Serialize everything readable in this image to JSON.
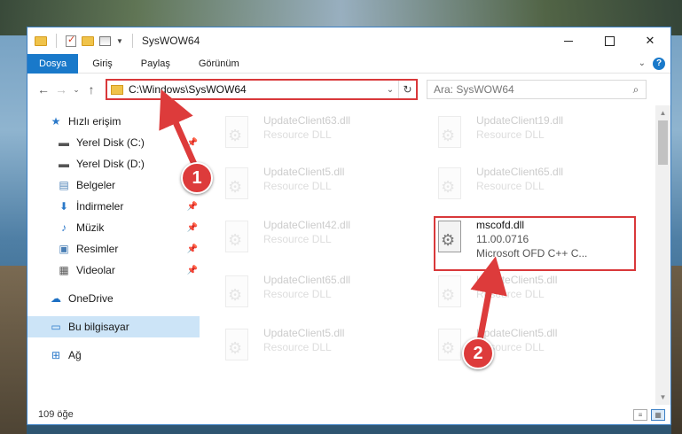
{
  "window": {
    "title": "SysWOW64"
  },
  "ribbon": {
    "tabs": [
      "Dosya",
      "Giriş",
      "Paylaş",
      "Görünüm"
    ]
  },
  "navigation": {
    "address": "C:\\Windows\\SysWOW64",
    "search_placeholder": "Ara: SysWOW64"
  },
  "sidebar": {
    "items": [
      {
        "label": "Hızlı erişim",
        "icon": "star-icon"
      },
      {
        "label": "Yerel Disk (C:)",
        "icon": "drive-icon"
      },
      {
        "label": "Yerel Disk (D:)",
        "icon": "drive-icon"
      },
      {
        "label": "Belgeler",
        "icon": "documents-icon"
      },
      {
        "label": "İndirmeler",
        "icon": "download-icon"
      },
      {
        "label": "Müzik",
        "icon": "music-icon"
      },
      {
        "label": "Resimler",
        "icon": "pictures-icon"
      },
      {
        "label": "Videolar",
        "icon": "video-icon"
      },
      {
        "label": "OneDrive",
        "icon": "cloud-icon"
      },
      {
        "label": "Bu bilgisayar",
        "icon": "computer-icon"
      },
      {
        "label": "Ağ",
        "icon": "network-icon"
      }
    ]
  },
  "files": [
    {
      "name": "UpdateClient63.dll",
      "type": "Resource DLL"
    },
    {
      "name": "UpdateClient19.dll",
      "type": "Resource DLL"
    },
    {
      "name": "UpdateClient5.dll",
      "type": "Resource DLL"
    },
    {
      "name": "UpdateClient65.dll",
      "type": "Resource DLL"
    },
    {
      "name": "UpdateClient42.dll",
      "type": "Resource DLL"
    },
    {
      "name": "mscofd.dll",
      "version": "11.00.0716",
      "type": "Microsoft OFD C++ C..."
    },
    {
      "name": "UpdateClient65.dll",
      "type": "Resource DLL"
    },
    {
      "name": "UpdateClient5.dll",
      "type": "Resource DLL"
    },
    {
      "name": "UpdateClient5.dll",
      "type": "Resource DLL"
    },
    {
      "name": "UpdateClient5.dll",
      "type": "Resource DLL"
    }
  ],
  "status": {
    "count": "109 öğe"
  },
  "callouts": [
    "1",
    "2"
  ],
  "colors": {
    "accent": "#1979ca",
    "highlight": "#d9383a",
    "selected": "#cce4f7"
  }
}
